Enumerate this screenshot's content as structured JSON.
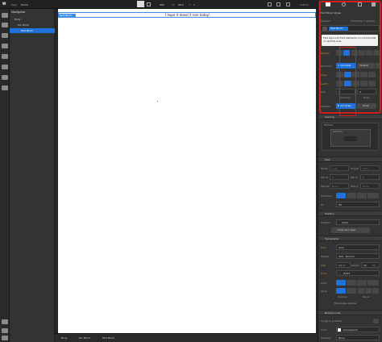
{
  "topbar": {
    "page_label": "Page:",
    "page_name": "Home",
    "width": "992",
    "px1": "PX",
    "height": "99.4",
    "pct": "%",
    "extra": "1",
    "publish": "Publish"
  },
  "navigator": {
    "title": "Navigator",
    "items": [
      {
        "label": "Body"
      },
      {
        "label": "Div Block"
      },
      {
        "label": "Text Block"
      }
    ]
  },
  "canvas": {
    "tag": "Text Block",
    "heading": "I hope it doesn't rain today!"
  },
  "breadcrumbs": [
    "Body",
    "Div Block",
    "Text Block"
  ],
  "panel": {
    "styles_label": "Text Block Styles",
    "selector_label": "Selector",
    "inheriting": "Inheriting 1 selector",
    "selector_chip": "Text Block",
    "tooltip": "Flex lays out child elements on a horizontal or vertical axis.",
    "display_label": "Display",
    "direction_label": "Direction",
    "horizontal": "Horizontal",
    "vertical": "Vertical",
    "align_label": "Align",
    "justify_label": "Justify",
    "gap_label": "Gap",
    "gap_value": "0",
    "gap_unit": "PX",
    "gap_extra": "0",
    "columns": "Columns",
    "rows": "Rows",
    "children_label": "Children",
    "dont_wrap": "Don't wrap",
    "wrap": "Wrap",
    "spacing": "Spacing",
    "margin": "MARGIN",
    "padding": "PADDING",
    "zero": "0",
    "size": "Size",
    "width": "Width",
    "height": "Height",
    "min_w": "Min W",
    "min_h": "Min H",
    "max_w": "Max W",
    "max_h": "Max H",
    "auto": "Auto",
    "none": "None",
    "zero_px": "0",
    "overflow": "Overflow",
    "fit": "Fit",
    "fill": "Fill",
    "position": "Position",
    "position_label": "Position",
    "static": "Static",
    "float_clear": "Float and clear",
    "typography": "Typography",
    "font": "Font",
    "font_value": "Arial",
    "weight": "Weight",
    "weight_value": "400 - Normal",
    "size_label": "Size",
    "size_value": "14",
    "size_unit": "PX",
    "lh_label": "Height",
    "lh_value": "20",
    "lh_unit": "PX",
    "color_label": "Color",
    "color_value": "#333",
    "align_t": "Align",
    "style": "Style",
    "italic_label": "Italicize",
    "deco": "Decor",
    "more_type": "More type options",
    "backgrounds": "Backgrounds",
    "image_gradient": "Image & gradient",
    "bg_color": "Color",
    "transparent": "transparent",
    "clipping": "Clipping",
    "none_clip": "None"
  },
  "colors": {
    "accent": "#1f72d9",
    "highlight": "#d01f1f",
    "amber": "#d8862b"
  }
}
